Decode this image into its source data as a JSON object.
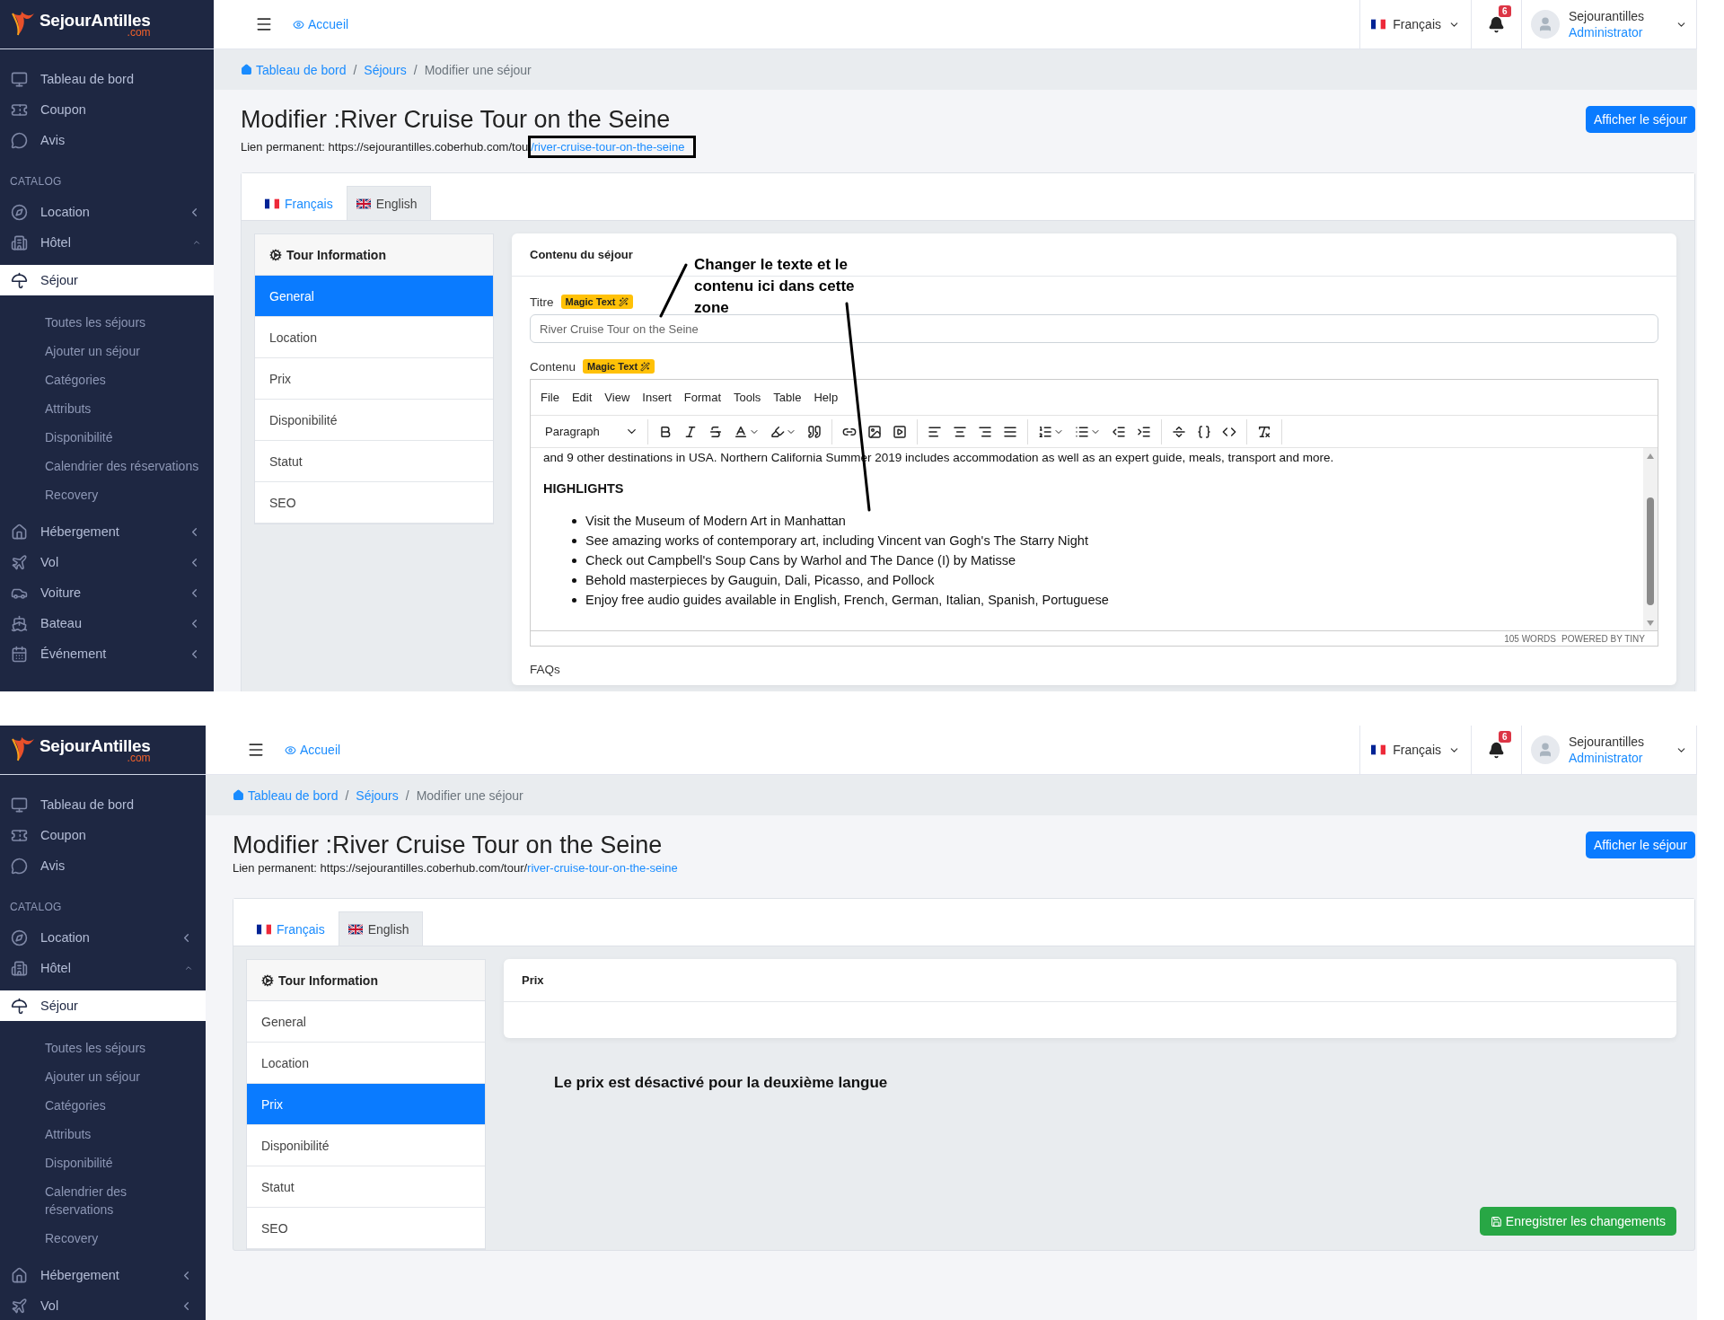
{
  "screens": [
    {
      "brand": {
        "name": "SejourAntilles",
        "suffix": ".com"
      },
      "topbar": {
        "home_link": "Accueil",
        "language": "Français",
        "notifications": "6",
        "user_name": "Sejourantilles",
        "user_role": "Administrator"
      },
      "sidebar": [
        {
          "kind": "item",
          "label": "Tableau de bord",
          "selected": false
        },
        {
          "kind": "item",
          "label": "Coupon",
          "selected": false
        },
        {
          "kind": "item",
          "label": "Avis",
          "selected": false
        },
        {
          "kind": "section",
          "label": "CATALOG"
        },
        {
          "kind": "item",
          "label": "Location",
          "selected": false,
          "expanded": false
        },
        {
          "kind": "item",
          "label": "Hôtel",
          "selected": false,
          "expanded": true
        },
        {
          "kind": "item",
          "label": "Séjour",
          "selected": true,
          "children": [
            {
              "label": "Toutes les séjours",
              "selected": false
            },
            {
              "label": "Ajouter un séjour",
              "selected": false
            },
            {
              "label": "Catégories",
              "selected": false
            },
            {
              "label": "Attributs",
              "selected": false
            },
            {
              "label": "Disponibilité",
              "selected": false
            },
            {
              "label": "Calendrier des réservations",
              "selected": false
            },
            {
              "label": "Recovery",
              "selected": false
            }
          ]
        },
        {
          "kind": "item",
          "label": "Hébergement",
          "selected": false,
          "expanded": false
        },
        {
          "kind": "item",
          "label": "Vol",
          "selected": false,
          "expanded": false
        },
        {
          "kind": "item",
          "label": "Voiture",
          "selected": false,
          "expanded": false
        },
        {
          "kind": "item",
          "label": "Bateau",
          "selected": false,
          "expanded": false
        },
        {
          "kind": "item",
          "label": "Événement",
          "selected": false,
          "expanded": false
        }
      ],
      "breadcrumb": {
        "separator": "/",
        "items": [
          {
            "label": "Tableau de bord",
            "link": true
          },
          {
            "label": "Séjours",
            "link": true
          },
          {
            "label": "Modifier une séjour",
            "link": false
          }
        ]
      },
      "page_title": "Modifier :River Cruise Tour on the Seine",
      "permalink": {
        "label": "Lien permanent: https://sejourantilles.coberhub.com/tou",
        "slug": "/river-cruise-tour-on-the-seine",
        "highlighted": true
      },
      "view_button": "Afficher le séjour",
      "language_tabs": [
        {
          "label": "Français",
          "selected": false
        },
        {
          "label": "English",
          "selected": true
        }
      ],
      "section_menu": {
        "title": "Tour Information",
        "items": [
          {
            "label": "General",
            "selected": true
          },
          {
            "label": "Location",
            "selected": false
          },
          {
            "label": "Prix",
            "selected": false
          },
          {
            "label": "Disponibilité",
            "selected": false
          },
          {
            "label": "Statut",
            "selected": false
          },
          {
            "label": "SEO",
            "selected": false
          }
        ]
      },
      "panel": {
        "kind": "form",
        "title": "Contenu du séjour",
        "title_field": {
          "label": "Titre",
          "badge": "Magic Text",
          "value": "River Cruise Tour on the Seine"
        },
        "content_field": {
          "label": "Contenu",
          "badge": "Magic Text"
        },
        "editor": {
          "menu": [
            "File",
            "Edit",
            "View",
            "Insert",
            "Format",
            "Tools",
            "Table",
            "Help"
          ],
          "block_format": "Paragraph",
          "cut_line": "and 9 other destinations in USA. Northern California Summer 2019 includes accommodation as well as an expert guide, meals, transport and more.",
          "heading": "HIGHLIGHTS",
          "bullets": [
            "Visit the Museum of Modern Art in Manhattan",
            "See amazing works of contemporary art, including Vincent van Gogh's The Starry Night",
            "Check out Campbell's Soup Cans by Warhol and The Dance (I) by Matisse",
            "Behold masterpieces by Gauguin, Dali, Picasso, and Pollock",
            "Enjoy free audio guides available in English, French, German, Italian, Spanish, Portuguese"
          ],
          "word_count": "105 WORDS",
          "powered_by": "POWERED BY TINY"
        },
        "next_label": "FAQs"
      },
      "annotation": "Changer le texte et le contenu ici dans cette zone"
    },
    {
      "brand": {
        "name": "SejourAntilles",
        "suffix": ".com"
      },
      "topbar": {
        "home_link": "Accueil",
        "language": "Français",
        "notifications": "6",
        "user_name": "Sejourantilles",
        "user_role": "Administrator"
      },
      "sidebar": [
        {
          "kind": "item",
          "label": "Tableau de bord",
          "selected": false
        },
        {
          "kind": "item",
          "label": "Coupon",
          "selected": false
        },
        {
          "kind": "item",
          "label": "Avis",
          "selected": false
        },
        {
          "kind": "section",
          "label": "CATALOG"
        },
        {
          "kind": "item",
          "label": "Location",
          "selected": false,
          "expanded": false
        },
        {
          "kind": "item",
          "label": "Hôtel",
          "selected": false,
          "expanded": true
        },
        {
          "kind": "item",
          "label": "Séjour",
          "selected": true,
          "children": [
            {
              "label": "Toutes les séjours",
              "selected": false
            },
            {
              "label": "Ajouter un séjour",
              "selected": false
            },
            {
              "label": "Catégories",
              "selected": false
            },
            {
              "label": "Attributs",
              "selected": false
            },
            {
              "label": "Disponibilité",
              "selected": false
            },
            {
              "label": "Calendrier des réservations",
              "selected": false
            },
            {
              "label": "Recovery",
              "selected": false
            }
          ]
        },
        {
          "kind": "item",
          "label": "Hébergement",
          "selected": false,
          "expanded": false
        },
        {
          "kind": "item",
          "label": "Vol",
          "selected": false,
          "expanded": false
        }
      ],
      "breadcrumb": {
        "separator": "/",
        "items": [
          {
            "label": "Tableau de bord",
            "link": true
          },
          {
            "label": "Séjours",
            "link": true
          },
          {
            "label": "Modifier une séjour",
            "link": false
          }
        ]
      },
      "page_title": "Modifier :River Cruise Tour on the Seine",
      "permalink": {
        "label": "Lien permanent: https://sejourantilles.coberhub.com/tour/",
        "slug": "river-cruise-tour-on-the-seine",
        "highlighted": false
      },
      "view_button": "Afficher le séjour",
      "language_tabs": [
        {
          "label": "Français",
          "selected": false
        },
        {
          "label": "English",
          "selected": true
        }
      ],
      "section_menu": {
        "title": "Tour Information",
        "items": [
          {
            "label": "General",
            "selected": false
          },
          {
            "label": "Location",
            "selected": false
          },
          {
            "label": "Prix",
            "selected": true
          },
          {
            "label": "Disponibilité",
            "selected": false
          },
          {
            "label": "Statut",
            "selected": false
          },
          {
            "label": "SEO",
            "selected": false
          }
        ]
      },
      "panel": {
        "kind": "price",
        "title": "Prix",
        "note": "Le prix est désactivé pour la deuxième langue",
        "save_button": "Enregistrer les changements"
      }
    }
  ]
}
